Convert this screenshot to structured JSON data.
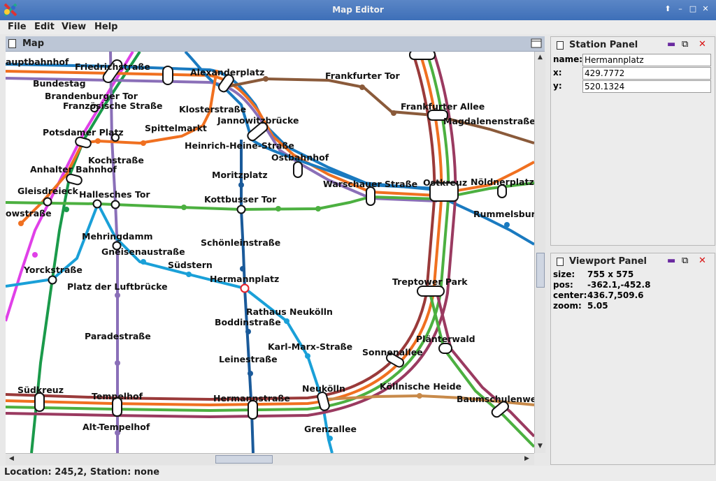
{
  "window": {
    "title": "Map Editor"
  },
  "menu": [
    "File",
    "Edit",
    "View",
    "Help"
  ],
  "map_panel": {
    "title": "Map"
  },
  "station_panel": {
    "title": "Station Panel",
    "name_label": "name:",
    "name_value": "Hermannplatz",
    "x_label": "x:",
    "x_value": "429.7772",
    "y_label": "y:",
    "y_value": "520.1324"
  },
  "viewport_panel": {
    "title": "Viewport Panel",
    "size_label": "size:",
    "size_value": "755 x 575",
    "pos_label": "pos:",
    "pos_value": "-362.1,-452.8",
    "center_label": "center:",
    "center_value": "436.7,509.6",
    "zoom_label": "zoom:",
    "zoom_value": "5.05"
  },
  "status": {
    "text": "Location: 245,2, Station: none"
  },
  "colors": {
    "title_bar": "#4a7cc0",
    "panel_header": "#bcc6d6",
    "selected_station": "#e8202a"
  },
  "stations": {
    "hauptbahnhof": "auptbahnhof",
    "friedrichstrasse": "Friedrichstraße",
    "alexanderplatz": "Alexanderplatz",
    "frankfurter_tor": "Frankfurter Tor",
    "bundestag": "Bundestag",
    "brandenburger_tor": "Brandenburger Tor",
    "franzoesische": "Französische Straße",
    "klosterstrasse": "Klosterstraße",
    "jannowitz": "Jannowitzbrücke",
    "frankfurter_allee": "Frankfurter Allee",
    "magdalenen": "Magdalenenstraße",
    "potsdamer": "Potsdamer Platz",
    "spittelmarkt": "Spittelmarkt",
    "heinrich_heine": "Heinrich-Heine-Straße",
    "ostbahnhof": "Ostbahnhof",
    "kochstrasse": "Kochstraße",
    "anhalter": "Anhalter Bahnhof",
    "moritzplatz": "Moritzplatz",
    "warschauer": "Warschauer Straße",
    "ostkreuz": "Ostkreuz",
    "noeldner": "Nöldnerplatz",
    "gleisdreieck": "Gleisdreieck",
    "hallesches": "Hallesches Tor",
    "kottbusser": "Kottbusser Tor",
    "yorckstrasse_left": "owstraße",
    "rummelsburg": "Rummelsbur",
    "mehringdamm": "Mehringdamm",
    "schoenlein": "Schönleinstraße",
    "gneisenau": "Gneisenaustraße",
    "suedstern": "Südstern",
    "yorckstrasse": "Yorckstraße",
    "hermannplatz": "Hermannplatz",
    "treptower": "Treptower Park",
    "platz_luftbruecke": "Platz der Luftbrücke",
    "rathaus_neukoelln": "Rathaus Neukölln",
    "boddin": "Boddinstraße",
    "paradestrasse": "Paradestraße",
    "planterwald": "Plänterwald",
    "karl_marx": "Karl-Marx-Straße",
    "sonnenallee": "Sonnenallee",
    "leinestrasse": "Leinestraße",
    "koellnische": "Köllnische Heide",
    "suedkreuz": "Südkreuz",
    "tempelhof": "Tempelhof",
    "neukoelln": "Neukölln",
    "hermannstrasse": "Hermannstraße",
    "baumschulenweg": "Baumschulenwe",
    "alt_tempelhof": "Alt-Tempelhof",
    "grenzallee": "Grenzallee"
  }
}
